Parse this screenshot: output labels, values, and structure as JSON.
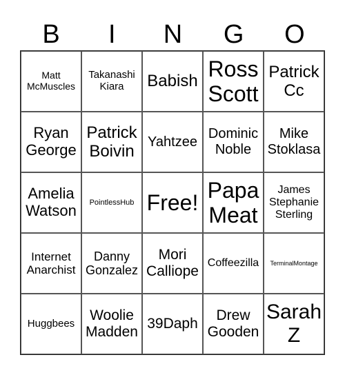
{
  "header": [
    "B",
    "I",
    "N",
    "G",
    "O"
  ],
  "cells": [
    "Matt McMuscles",
    "Takanashi Kiara",
    "Babish",
    "Ross Scott",
    "Patrick Cc",
    "Ryan George",
    "Patrick Boivin",
    "Yahtzee",
    "Dominic Noble",
    "Mike Stoklasa",
    "Amelia Watson",
    "PointlessHub",
    "Free!",
    "Papa Meat",
    "James Stephanie Sterling",
    "Internet Anarchist",
    "Danny Gonzalez",
    "Mori Calliope",
    "Coffeezilla",
    "TerminalMontage",
    "Huggbees",
    "Woolie Madden",
    "39Daph",
    "Drew Gooden",
    "Sarah Z"
  ]
}
